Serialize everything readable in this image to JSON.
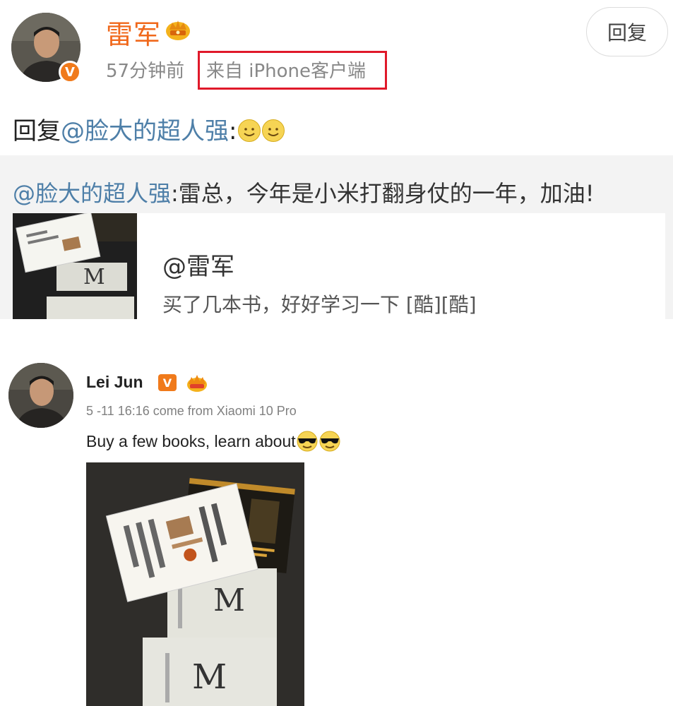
{
  "top_post": {
    "name": "雷军",
    "time": "57分钟前",
    "source": "来自 iPhone客户端",
    "reply_button": "回复",
    "reply_prefix": "回复",
    "reply_mention": "@脸大的超人强",
    "reply_colon": ":",
    "quote_mention": "@脸大的超人强",
    "quote_text": ":雷总，今年是小米打翻身仗的一年，加油!",
    "ref_name": "@雷军",
    "ref_text": "买了几本书，好好学习一下 [酷][酷]",
    "badge_letter": "V",
    "colors": {
      "name": "#f0681b",
      "mention": "#4e7fa8",
      "highlight_box": "#e0192a"
    }
  },
  "post": {
    "name": "Lei Jun",
    "badge_letter": "V",
    "meta": "5 -11 16:16 come from Xiaomi 10 Pro",
    "text": "Buy a few books, learn about"
  },
  "icons": [
    "crown-icon",
    "verified-badge-icon",
    "smiley-emoji-icon",
    "cool-sunglasses-emoji-icon"
  ]
}
